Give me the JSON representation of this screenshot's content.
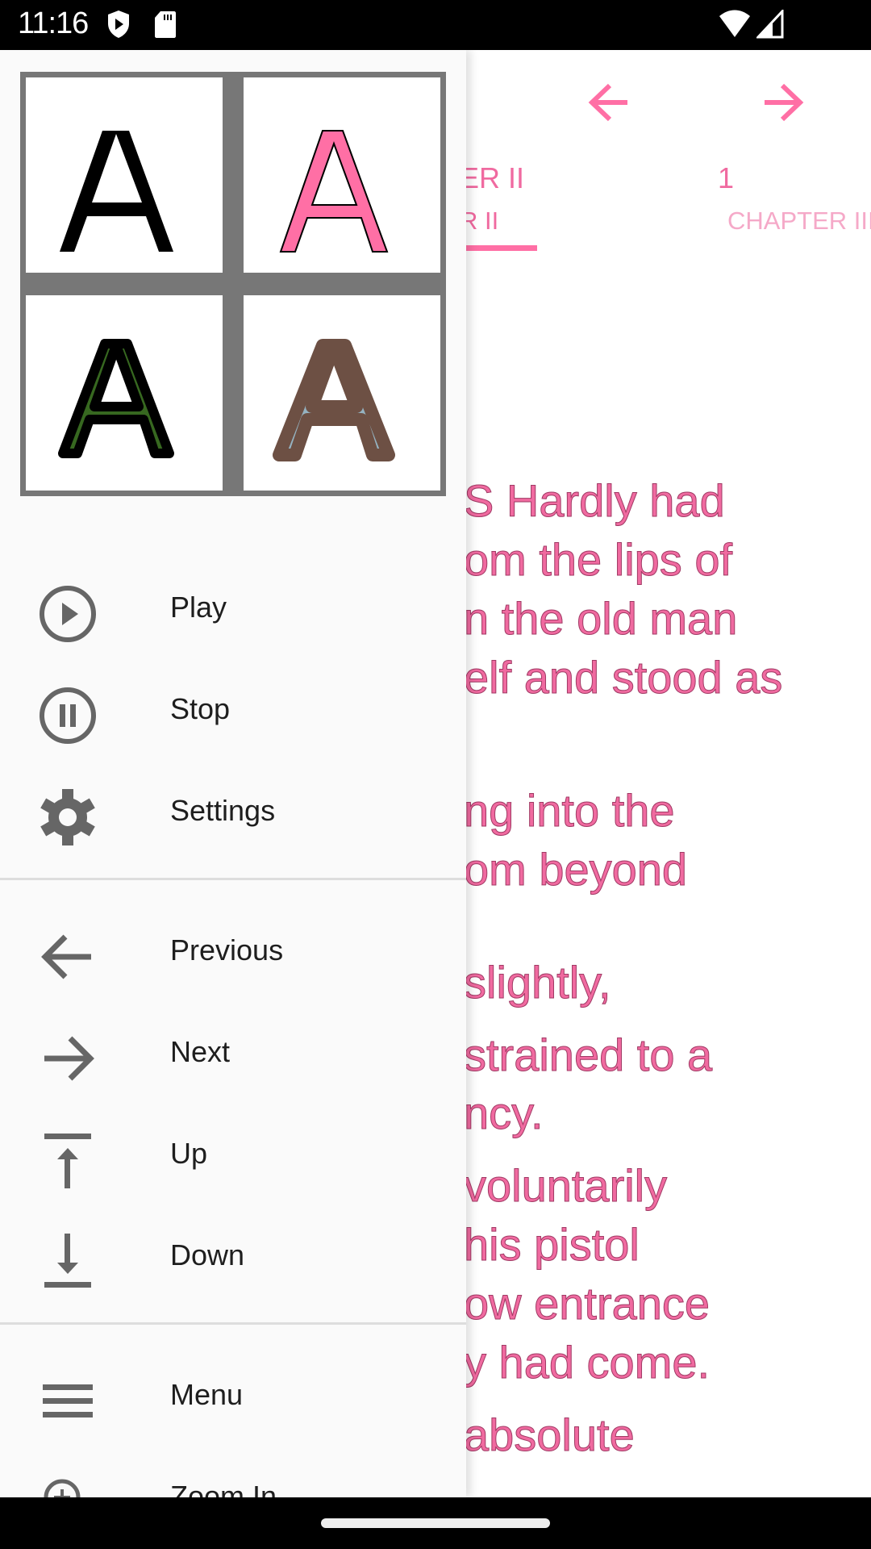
{
  "status_bar": {
    "time": "11:16",
    "left_icons": [
      "shield-play-icon",
      "sd-card-icon"
    ],
    "right_icons": [
      "wifi-icon",
      "cell-signal-icon"
    ]
  },
  "reader": {
    "accent_color": "#f06aa0",
    "nav": {
      "prev_icon": "arrow-left-icon",
      "next_icon": "arrow-right-icon"
    },
    "tabs": {
      "current_title_partial": "ER II",
      "page_number": "1",
      "current_tab_partial": "R II",
      "next_tab": "CHAPTER III"
    },
    "text_lines": [
      "S Hardly had",
      "om the lips of",
      "n the old man",
      "elf and stood as",
      "ng into the",
      "om beyond",
      "slightly,",
      " strained to a",
      "ncy.",
      "voluntarily",
      " his pistol",
      "ow entrance",
      "y had come.",
      "absolute"
    ]
  },
  "drawer": {
    "style_swatches": [
      {
        "name": "black-plain",
        "fill": "#000000",
        "stroke": "none"
      },
      {
        "name": "pink-thin-outline",
        "fill": "#ff6fa5",
        "stroke": "#000000"
      },
      {
        "name": "green-black-outline",
        "fill": "#376820",
        "stroke": "#000000"
      },
      {
        "name": "blue-brown-outline",
        "fill": "#95b3c1",
        "stroke": "#6d5044"
      }
    ],
    "groups": [
      [
        {
          "label": "Play",
          "icon": "play-circle-icon"
        },
        {
          "label": "Stop",
          "icon": "pause-circle-icon"
        },
        {
          "label": "Settings",
          "icon": "gear-icon"
        }
      ],
      [
        {
          "label": "Previous",
          "icon": "arrow-left-icon"
        },
        {
          "label": "Next",
          "icon": "arrow-right-icon"
        },
        {
          "label": "Up",
          "icon": "arrow-up-to-top-icon"
        },
        {
          "label": "Down",
          "icon": "arrow-down-to-bottom-icon"
        }
      ],
      [
        {
          "label": "Menu",
          "icon": "menu-icon"
        },
        {
          "label": "Zoom In",
          "icon": "zoom-in-icon"
        }
      ]
    ]
  }
}
